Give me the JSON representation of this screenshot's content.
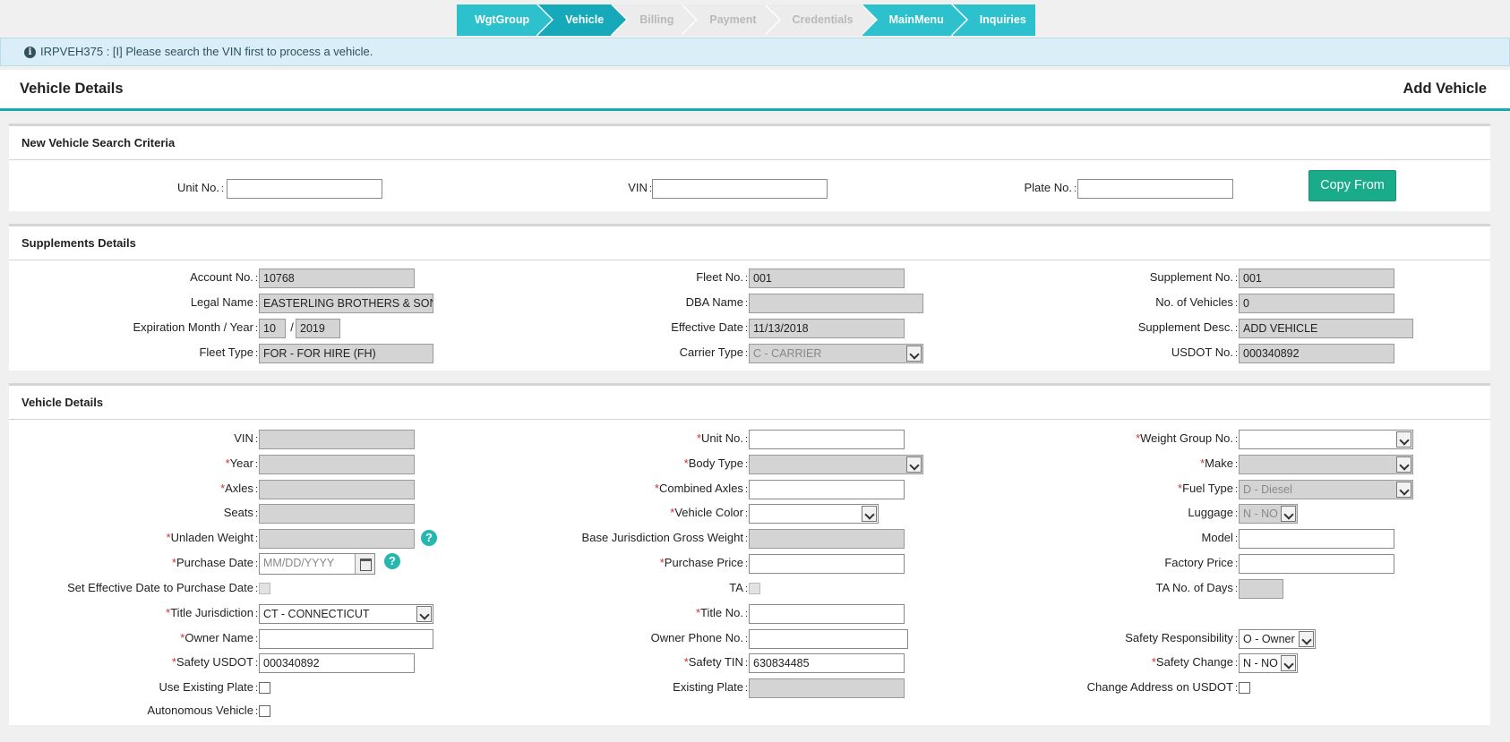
{
  "wizard": {
    "steps": [
      {
        "label": "WgtGroup",
        "state": "done"
      },
      {
        "label": "Vehicle",
        "state": "active"
      },
      {
        "label": "Billing",
        "state": "todo"
      },
      {
        "label": "Payment",
        "state": "todo"
      },
      {
        "label": "Credentials",
        "state": "todo"
      },
      {
        "label": "MainMenu",
        "state": "done"
      },
      {
        "label": "Inquiries",
        "state": "done"
      }
    ]
  },
  "alert": {
    "text": "IRPVEH375 : [I] Please search the VIN first to process a vehicle."
  },
  "header": {
    "title": "Vehicle Details",
    "action": "Add Vehicle"
  },
  "search": {
    "title": "New Vehicle Search Criteria",
    "unit_label": "Unit No.",
    "vin_label": "VIN",
    "plate_label": "Plate No.",
    "unit_value": "",
    "vin_value": "",
    "plate_value": "",
    "copy_button": "Copy From"
  },
  "supplements": {
    "title": "Supplements Details",
    "account_label": "Account No.",
    "account_value": "10768",
    "fleet_label": "Fleet No.",
    "fleet_value": "001",
    "supp_label": "Supplement No.",
    "supp_value": "001",
    "legal_label": "Legal Name",
    "legal_value": "EASTERLING BROTHERS & SON",
    "dba_label": "DBA Name",
    "dba_value": "",
    "novehicles_label": "No. of Vehicles",
    "novehicles_value": "0",
    "exp_label": "Expiration Month / Year",
    "exp_month": "10",
    "exp_sep": "/",
    "exp_year": "2019",
    "effdate_label": "Effective Date",
    "effdate_value": "11/13/2018",
    "suppdesc_label": "Supplement Desc.",
    "suppdesc_value": "ADD VEHICLE",
    "fleettype_label": "Fleet Type",
    "fleettype_value": "FOR - FOR HIRE (FH)",
    "carrier_label": "Carrier Type",
    "carrier_value": "C - CARRIER",
    "usdot_label": "USDOT No.",
    "usdot_value": "000340892"
  },
  "vehicle": {
    "title": "Vehicle Details",
    "vin_label": "VIN",
    "vin_value": "",
    "unit_label": "Unit No.",
    "unit_value": "",
    "wgroup_label": "Weight Group No.",
    "wgroup_value": "",
    "year_label": "Year",
    "year_value": "",
    "body_label": "Body Type",
    "body_value": "",
    "make_label": "Make",
    "make_value": "",
    "axles_label": "Axles",
    "axles_value": "",
    "caxles_label": "Combined Axles",
    "caxles_value": "",
    "fuel_label": "Fuel Type",
    "fuel_value": "D - Diesel",
    "seats_label": "Seats",
    "seats_value": "",
    "color_label": "Vehicle Color",
    "color_value": "",
    "luggage_label": "Luggage",
    "luggage_value": "N - NO",
    "unladen_label": "Unladen Weight",
    "unladen_value": "",
    "bjgw_label": "Base Jurisdiction Gross Weight",
    "bjgw_value": "",
    "model_label": "Model",
    "model_value": "",
    "pdate_label": "Purchase Date",
    "pdate_placeholder": "MM/DD/YYYY",
    "pprice_label": "Purchase Price",
    "pprice_value": "",
    "fprice_label": "Factory Price",
    "fprice_value": "",
    "seteff_label": "Set Effective Date to Purchase Date",
    "ta_label": "TA",
    "tadays_label": "TA No. of Days",
    "tadays_value": "",
    "titlej_label": "Title Jurisdiction",
    "titlej_value": "CT - CONNECTICUT",
    "titleno_label": "Title No.",
    "titleno_value": "",
    "owner_label": "Owner Name",
    "owner_value": "",
    "ownerphone_label": "Owner Phone No.",
    "ownerphone_value": "",
    "safetyresp_label": "Safety Responsibility",
    "safetyresp_value": "O - Owner",
    "safetyusdot_label": "Safety USDOT",
    "safetyusdot_value": "000340892",
    "safetytin_label": "Safety TIN",
    "safetytin_value": "630834485",
    "safetychange_label": "Safety Change",
    "safetychange_value": "N - NO",
    "useplate_label": "Use Existing Plate",
    "existplate_label": "Existing Plate",
    "existplate_value": "",
    "changeaddr_label": "Change Address on USDOT",
    "autonomous_label": "Autonomous Vehicle",
    "help_glyph": "?",
    "required_mark": "*",
    "colon": ":"
  },
  "icons": {
    "info": "info-icon",
    "help": "help-icon",
    "calendar": "calendar-icon",
    "dropdown": "chevron-down-icon"
  }
}
